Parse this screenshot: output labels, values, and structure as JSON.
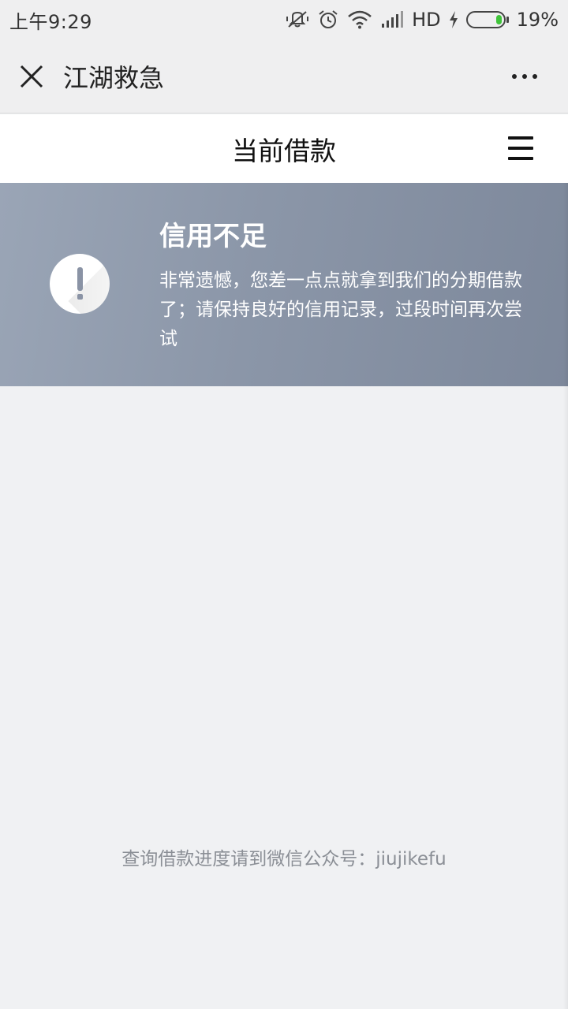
{
  "status_bar": {
    "time": "上午9:29",
    "network": "HD",
    "battery_percent": "19%",
    "battery_level": 0.19,
    "icons": [
      "mute-vibrate-icon",
      "alarm-icon",
      "wifi-icon",
      "signal-icon",
      "charging-icon",
      "battery-icon"
    ]
  },
  "nav": {
    "title": "江湖救急",
    "close_icon": "close-icon",
    "more_icon": "more-icon"
  },
  "header": {
    "title": "当前借款",
    "menu_icon": "menu-icon"
  },
  "banner": {
    "title": "信用不足",
    "message": "非常遗憾，您差一点点就拿到我们的分期借款了；请保持良好的信用记录，过段时间再次尝试",
    "icon": "exclamation-icon",
    "colors": {
      "start": "#9aa5b6",
      "end": "#7d889b"
    }
  },
  "footer": {
    "note": "查询借款进度请到微信公众号：jiujikefu"
  }
}
